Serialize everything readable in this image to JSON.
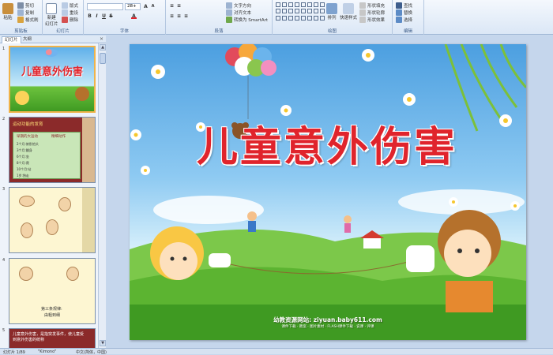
{
  "ribbon": {
    "clipboard": {
      "label": "剪贴板",
      "paste": "粘贴",
      "cut": "剪切",
      "copy": "复制",
      "format_painter": "格式刷"
    },
    "slides": {
      "label": "幻灯片",
      "new_slide": "新建\n幻灯片",
      "layout": "版式",
      "reset": "重设",
      "delete": "删除"
    },
    "font": {
      "label": "字体",
      "font_size": "28+"
    },
    "paragraph": {
      "label": "段落",
      "text_direction": "文字方向",
      "align_text": "对齐文本",
      "smartart": "转换为 SmartArt"
    },
    "drawing": {
      "label": "绘图",
      "arrange": "排列",
      "quick_styles": "快速样式",
      "shape_fill": "形状填充",
      "shape_outline": "形状轮廓",
      "shape_effects": "形状效果"
    },
    "editing": {
      "label": "编辑",
      "find": "查找",
      "replace": "替换",
      "select": "选择"
    }
  },
  "panel": {
    "tabs": [
      "幻灯片",
      "大纲"
    ],
    "close": "×",
    "slides": [
      {
        "num": "1",
        "title": "儿童意外伤害"
      },
      {
        "num": "2",
        "title": "运动功能的发育",
        "col1": "早期的大运动",
        "col2": "精细动作",
        "lines": [
          "2个月:俯卧抬头",
          "3个月:翻身",
          "6个月:坐",
          "8个月:爬",
          "10个月:站",
          "1岁:独走"
        ]
      },
      {
        "num": "3"
      },
      {
        "num": "4",
        "caption": "第三条规律:",
        "caption2": "由粗到细"
      },
      {
        "num": "5",
        "text": "儿童意外伤害，是指突发事件，使儿童受到意外伤害的统称"
      }
    ]
  },
  "slide": {
    "title": "儿童意外伤害",
    "credit": "幼教资源网站: ziyuan.baby611.com",
    "credit2": "课件下载 · 教案 · 图片素材 · FLASH课件下载 · 说课 · 评课"
  },
  "statusbar": {
    "slide_info": "幻灯片 1/89",
    "theme": "\"Kimono\"",
    "language": "中文(简体，中国)"
  },
  "colors": {
    "title_red": "#e0242c",
    "sky": "#4c9fe0",
    "grass": "#5cb431"
  }
}
